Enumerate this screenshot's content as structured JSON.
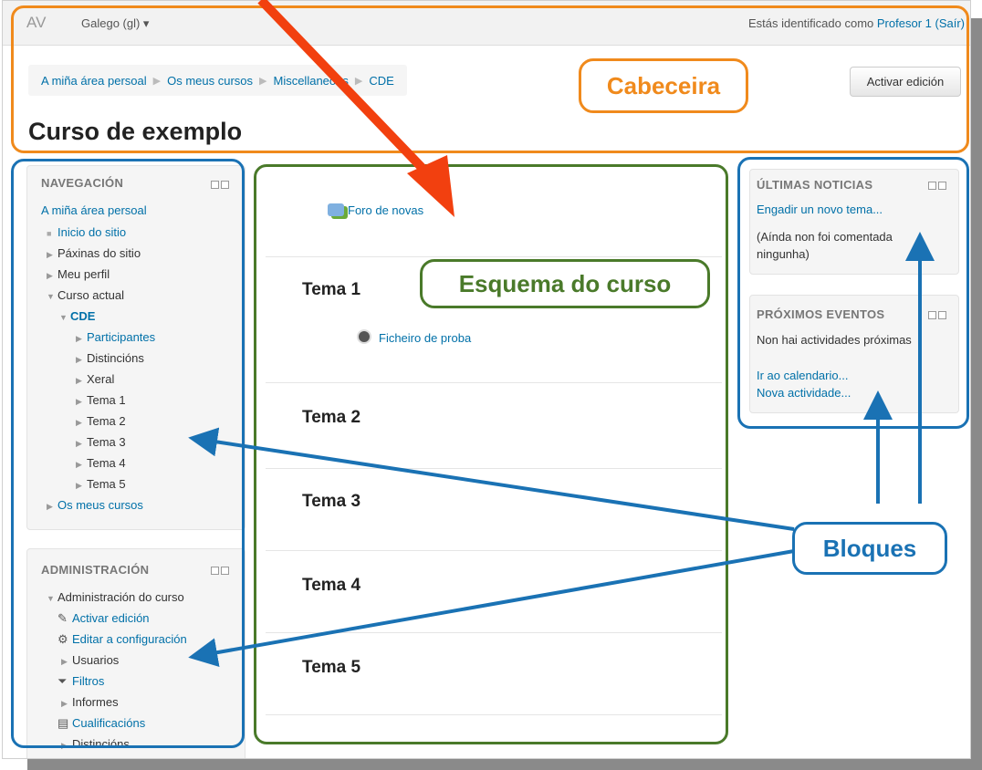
{
  "header": {
    "brand": "AV",
    "language": "Galego (gl) ▾",
    "login_text": "Estás identificado como ",
    "login_user": "Profesor 1",
    "login_logout": "(Saír)"
  },
  "breadcrumb": [
    "A miña área persoal",
    "Os meus cursos",
    "Miscellaneous",
    "CDE"
  ],
  "edit_button": "Activar edición",
  "page_title": "Curso de exemplo",
  "navigation": {
    "title": "NAVEGACIÓN",
    "items": [
      "A miña área persoal",
      "Inicio do sitio",
      "Páxinas do sitio",
      "Meu perfil",
      "Curso actual",
      "CDE",
      "Participantes",
      "Distincións",
      "Xeral",
      "Tema 1",
      "Tema 2",
      "Tema 3",
      "Tema 4",
      "Tema 5",
      "Os meus cursos"
    ]
  },
  "administration": {
    "title": "ADMINISTRACIÓN",
    "items": [
      "Administración do curso",
      "Activar edición",
      "Editar a configuración",
      "Usuarios",
      "Filtros",
      "Informes",
      "Cualificacións",
      "Distincións"
    ]
  },
  "main": {
    "forum": "Foro de novas",
    "sections": [
      "Tema 1",
      "Tema 2",
      "Tema 3",
      "Tema 4",
      "Tema 5"
    ],
    "file": "Ficheiro de proba"
  },
  "news": {
    "title": "ÚLTIMAS NOTICIAS",
    "add_link": "Engadir un novo tema...",
    "empty_line1": "(Aínda non foi comentada",
    "empty_line2": "ningunha)"
  },
  "events": {
    "title": "PRÓXIMOS EVENTOS",
    "empty": "Non hai actividades próximas",
    "calendar_link": "Ir ao calendario...",
    "new_link": "Nova actividade..."
  },
  "annotations": {
    "header_label": "Cabeceira",
    "outline_label": "Esquema do curso",
    "blocks_label": "Bloques",
    "orange": "#f08a1c",
    "green": "#4a7a2a",
    "blue": "#1a72b4",
    "red": "#f2400f"
  }
}
